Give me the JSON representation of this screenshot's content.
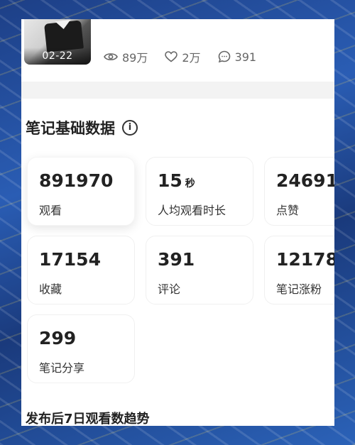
{
  "note": {
    "date": "02-22",
    "views": "89万",
    "likes": "2万",
    "comments": "391"
  },
  "section": {
    "title": "笔记基础数据",
    "info_icon": "info-circle-icon"
  },
  "metrics": [
    {
      "value": "891970",
      "unit": "",
      "label": "观看"
    },
    {
      "value": "15",
      "unit": "秒",
      "label": "人均观看时长"
    },
    {
      "value": "24691",
      "unit": "",
      "label": "点赞"
    },
    {
      "value": "17154",
      "unit": "",
      "label": "收藏"
    },
    {
      "value": "391",
      "unit": "",
      "label": "评论"
    },
    {
      "value": "12178",
      "unit": "",
      "label": "笔记涨粉"
    },
    {
      "value": "299",
      "unit": "",
      "label": "笔记分享"
    }
  ],
  "trend": {
    "title": "发布后7日观看数趋势"
  },
  "icons": {
    "views": "eye-icon",
    "likes": "heart-icon",
    "comments": "comment-icon"
  }
}
